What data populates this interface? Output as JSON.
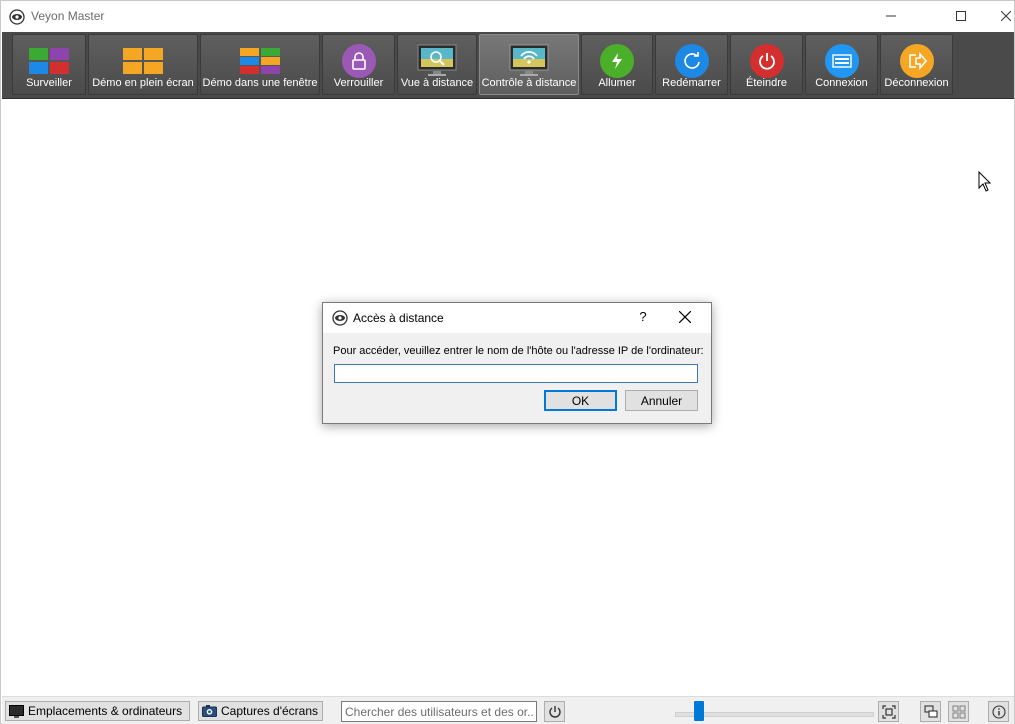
{
  "window": {
    "title": "Veyon Master"
  },
  "toolbar": {
    "items": [
      {
        "id": "monitor",
        "label": "Surveiller",
        "icon": "monitor-grid-icon"
      },
      {
        "id": "demo-fullscreen",
        "label": "Démo en plein écran",
        "icon": "demo-fullscreen-icon"
      },
      {
        "id": "demo-window",
        "label": "Démo dans une fenêtre",
        "icon": "demo-window-icon"
      },
      {
        "id": "lock",
        "label": "Verrouiller",
        "icon": "lock-icon"
      },
      {
        "id": "remote-view",
        "label": "Vue à distance",
        "icon": "remote-view-icon"
      },
      {
        "id": "remote-control",
        "label": "Contrôle à distance",
        "icon": "remote-control-icon",
        "active": true
      },
      {
        "id": "power-on",
        "label": "Allumer",
        "icon": "power-on-icon"
      },
      {
        "id": "reboot",
        "label": "Redémarrer",
        "icon": "reboot-icon"
      },
      {
        "id": "shutdown",
        "label": "Éteindre",
        "icon": "shutdown-icon"
      },
      {
        "id": "login",
        "label": "Connexion",
        "icon": "login-icon"
      },
      {
        "id": "logout",
        "label": "Déconnexion",
        "icon": "logout-icon"
      }
    ]
  },
  "dialog": {
    "title": "Accès à distance",
    "help": "?",
    "prompt": "Pour accéder, veuillez entrer le nom de l'hôte ou l'adresse IP de l'ordinateur:",
    "input_value": "",
    "ok_label": "OK",
    "cancel_label": "Annuler"
  },
  "statusbar": {
    "locations_label": "Emplacements & ordinateurs",
    "screenshots_label": "Captures d'écrans",
    "search_placeholder": "Chercher des utilisateurs et des or...",
    "zoom_fraction": 0.1
  },
  "colors": {
    "toolbar_bg": "#4a4a4a",
    "accent": "#0078d7",
    "lock": "#9b59b6",
    "power_on": "#4caf2a",
    "reboot": "#1e88e5",
    "shutdown": "#d32f2f",
    "login": "#2196f3",
    "logout": "#f5a623"
  }
}
